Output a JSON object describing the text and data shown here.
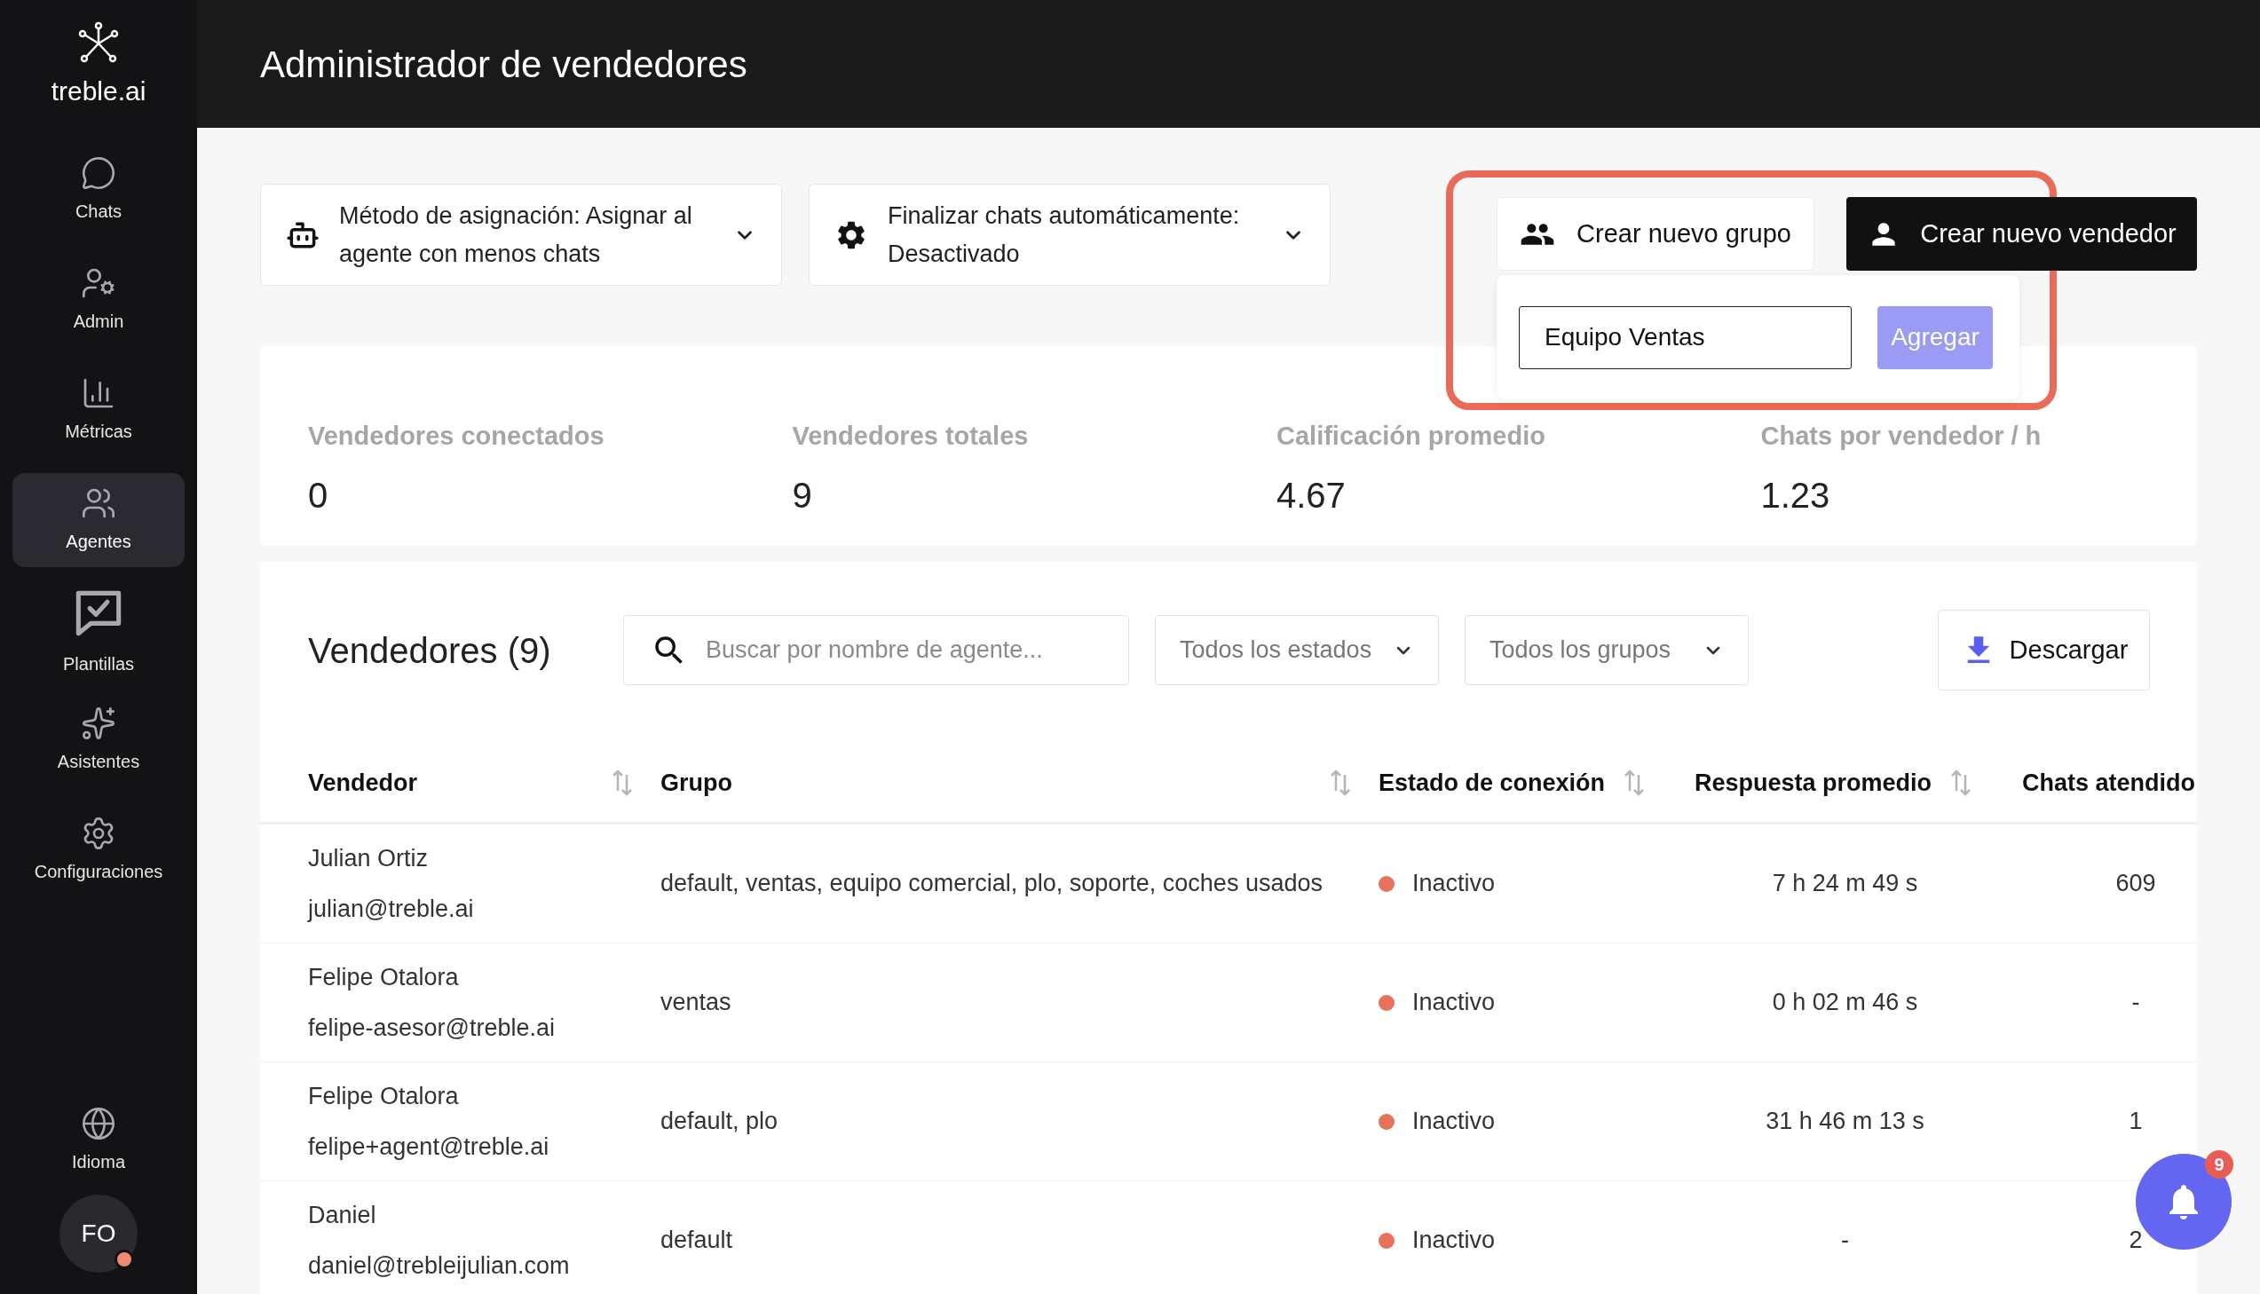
{
  "sidebar": {
    "logo": "treble.ai",
    "items": [
      {
        "label": "Chats",
        "selected": false
      },
      {
        "label": "Admin",
        "selected": false
      },
      {
        "label": "Métricas",
        "selected": false
      },
      {
        "label": "Agentes",
        "selected": true
      },
      {
        "label": "Plantillas",
        "selected": false
      },
      {
        "label": "Asistentes",
        "selected": false
      },
      {
        "label": "Configuraciones",
        "selected": false
      }
    ],
    "language": "Idioma",
    "avatar": "FO"
  },
  "header": {
    "title": "Administrador de vendedores"
  },
  "settings": [
    {
      "label": "Método de asignación: Asignar al agente con menos chats"
    },
    {
      "label": "Finalizar chats automáticamente: Desactivado"
    }
  ],
  "actions": {
    "new_group": "Crear nuevo grupo",
    "new_seller": "Crear nuevo vendedor"
  },
  "group_popover": {
    "value": "Equipo Ventas",
    "button": "Agregar"
  },
  "stats": [
    {
      "label": "Vendedores conectados",
      "value": "0"
    },
    {
      "label": "Vendedores totales",
      "value": "9"
    },
    {
      "label": "Calificación promedio",
      "value": "4.67"
    },
    {
      "label": "Chats por vendedor / h",
      "value": "1.23"
    }
  ],
  "sellers": {
    "title": "Vendedores (9)",
    "search": {
      "placeholder": "Buscar por nombre de agente..."
    },
    "filters": [
      "Todos los estados",
      "Todos los grupos"
    ],
    "download": "Descargar",
    "columns": [
      {
        "label": "Vendedor",
        "sortable": true
      },
      {
        "label": "Grupo",
        "sortable": true
      },
      {
        "label": "Estado de conexión",
        "sortable": true
      },
      {
        "label": "Respuesta promedio",
        "sortable": true
      },
      {
        "label": "Chats atendido",
        "sortable": false
      }
    ],
    "rows": [
      {
        "name": "Julian Ortiz",
        "email": "julian@treble.ai",
        "group": "default, ventas, equipo comercial, plo, soporte, coches usados",
        "status": "Inactivo",
        "color": "#e9705b",
        "response": "7 h 24 m 49 s",
        "chats": "609"
      },
      {
        "name": "Felipe Otalora",
        "email": "felipe-asesor@treble.ai",
        "group": "ventas",
        "status": "Inactivo",
        "color": "#e9705b",
        "response": "0 h 02 m 46 s",
        "chats": "-"
      },
      {
        "name": "Felipe Otalora",
        "email": "felipe+agent@treble.ai",
        "group": "default, plo",
        "status": "Inactivo",
        "color": "#e9705b",
        "response": "31 h 46 m 13 s",
        "chats": "1"
      },
      {
        "name": "Daniel",
        "email": "daniel@trebleijulian.com",
        "group": "default",
        "status": "Inactivo",
        "color": "#e9705b",
        "response": "-",
        "chats": "2"
      }
    ]
  },
  "notifications": {
    "count": "9"
  }
}
